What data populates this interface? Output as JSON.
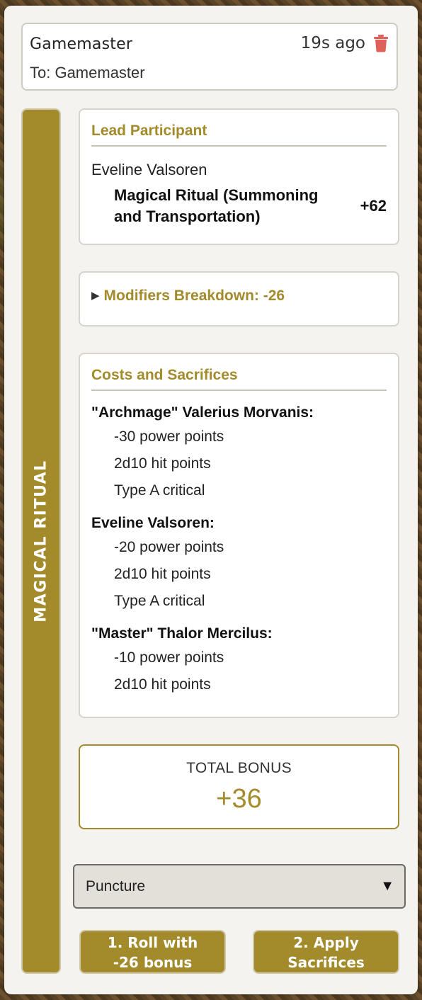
{
  "message": {
    "sender": "Gamemaster",
    "timestamp": "19s ago",
    "recipient": "To: Gamemaster"
  },
  "sidebar": {
    "label": "MAGICAL RITUAL"
  },
  "lead": {
    "title": "Lead Participant",
    "name": "Eveline Valsoren",
    "skill": "Magical Ritual (Summoning and Transportation)",
    "value": "+62"
  },
  "modifiers": {
    "label": "Modifiers Breakdown: -26"
  },
  "costs": {
    "title": "Costs and Sacrifices",
    "participants": [
      {
        "name": "\"Archmage\" Valerius Morvanis:",
        "lines": [
          "-30 power points",
          "2d10 hit points",
          "Type A critical"
        ]
      },
      {
        "name": "Eveline Valsoren:",
        "lines": [
          "-20 power points",
          "2d10 hit points",
          "Type A critical"
        ]
      },
      {
        "name": "\"Master\" Thalor Mercilus:",
        "lines": [
          "-10 power points",
          "2d10 hit points"
        ]
      }
    ]
  },
  "total": {
    "label": "TOTAL BONUS",
    "value": "+36"
  },
  "critical_select": {
    "value": "Puncture"
  },
  "buttons": {
    "roll_line1": "1. Roll with",
    "roll_line2": "-26 bonus",
    "apply_line1": "2. Apply",
    "apply_line2": "Sacrifices"
  },
  "colors": {
    "accent": "#a38b2b",
    "delete": "#e0605a",
    "card_bg": "#f4f3f0"
  },
  "icons": {
    "delete": "trash-icon",
    "expand": "triangle-right-icon",
    "dropdown": "caret-down-icon"
  }
}
